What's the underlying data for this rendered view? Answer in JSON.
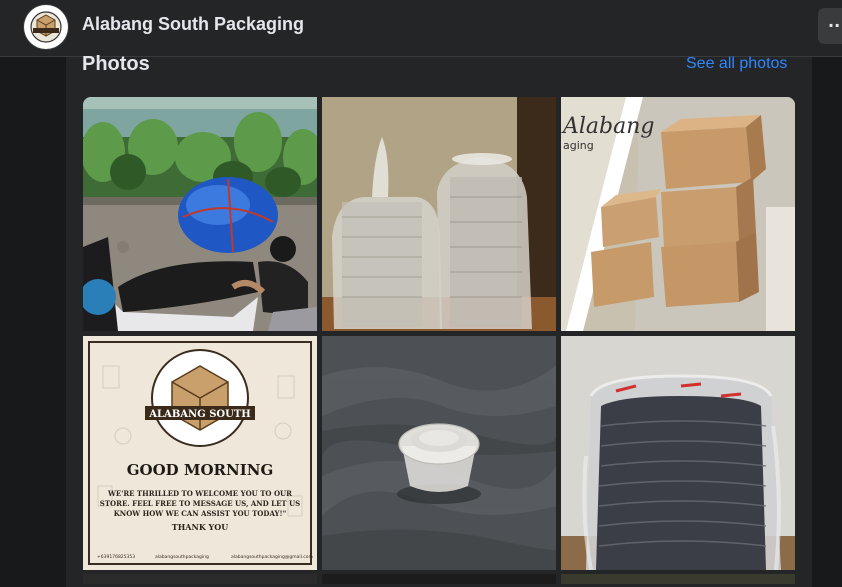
{
  "header": {
    "page_name": "Alabang South Packaging",
    "avatar_icon": "brand-logo-icon",
    "more_icon": "more-options-icon",
    "more_label": "··"
  },
  "photos_section": {
    "title": "Photos",
    "see_all_label": "See all photos",
    "link_color": "#2d88ff"
  },
  "post_card": {
    "brand_name": "ALABANG SOUTH",
    "greeting": "GOOD MORNING",
    "message_line1": "WE'RE THRILLED TO WELCOME YOU TO OUR",
    "message_line2": "STORE. FEEL FREE TO MESSAGE US, AND LET US",
    "message_line3": "KNOW HOW WE CAN ASSIST YOU TODAY!\"",
    "thanks": "THANK YOU",
    "footer_phone": "+639176825353",
    "footer_web": "alabangsouthpackaging",
    "footer_email": "alabangsouthpackaging@gmail.com"
  },
  "box_photo_text": {
    "brand_partial_top": "Alabang",
    "brand_partial_bottom": "aging"
  },
  "colors": {
    "background": "#18191a",
    "surface": "#242526",
    "text": "#e4e6eb"
  }
}
